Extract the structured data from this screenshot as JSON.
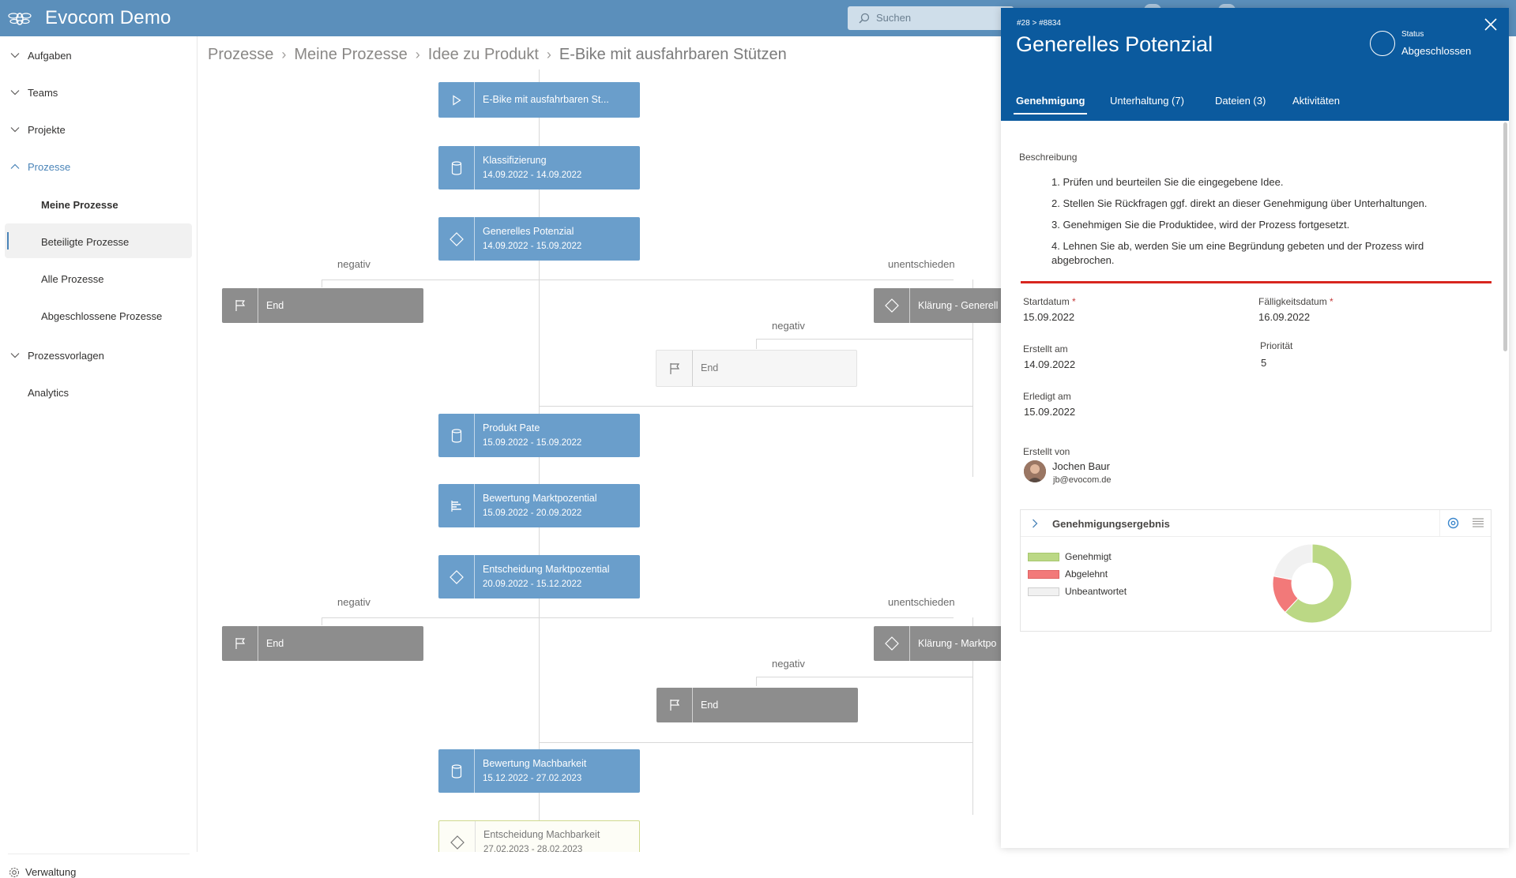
{
  "app": {
    "title": "Evocom Demo",
    "search_placeholder": "Suchen"
  },
  "sidebar": {
    "items": [
      {
        "label": "Aufgaben"
      },
      {
        "label": "Teams"
      },
      {
        "label": "Projekte"
      },
      {
        "label": "Prozesse"
      },
      {
        "label": "Meine Prozesse"
      },
      {
        "label": "Beteiligte Prozesse"
      },
      {
        "label": "Alle Prozesse"
      },
      {
        "label": "Abgeschlossene Prozesse"
      },
      {
        "label": "Prozessvorlagen"
      },
      {
        "label": "Analytics"
      }
    ],
    "footer": "Verwaltung",
    "accent_color": "#4a84b8"
  },
  "breadcrumb": [
    "Prozesse",
    "Meine Prozesse",
    "Idee zu Produkt",
    "E-Bike mit ausfahrbaren Stützen"
  ],
  "flow": {
    "start": {
      "title": "E-Bike mit ausfahrbaren St..."
    },
    "classification": {
      "title": "Klassifizierung",
      "dates": "14.09.2022 - 14.09.2022"
    },
    "potential": {
      "title": "Generelles Potenzial",
      "dates": "14.09.2022 - 15.09.2022"
    },
    "branch_negative_1": "negativ",
    "branch_undecided_1": "unentschieden",
    "end_1": "End",
    "clarify_1": "Klärung - Generell",
    "branch_negative_1b": "negativ",
    "end_1b": "End",
    "pate": {
      "title": "Produkt Pate",
      "dates": "15.09.2022 - 15.09.2022"
    },
    "market_eval": {
      "title": "Bewertung Marktpozential",
      "dates": "15.09.2022 - 20.09.2022"
    },
    "market_decision": {
      "title": "Entscheidung Marktpozential",
      "dates": "20.09.2022 - 15.12.2022"
    },
    "branch_negative_2": "negativ",
    "branch_undecided_2": "unentschieden",
    "end_2": "End",
    "clarify_2": "Klärung - Marktpo",
    "branch_negative_2b": "negativ",
    "end_2b": "End",
    "feasibility": {
      "title": "Bewertung Machbarkeit",
      "dates": "15.12.2022 - 27.02.2023"
    },
    "feasibility_decision": {
      "title": "Entscheidung Machbarkeit",
      "dates": "27.02.2023 - 28.02.2023"
    }
  },
  "panel": {
    "crumb": "#28 >  #8834",
    "title": "Generelles Potenzial",
    "status_label": "Status",
    "status_value": "Abgeschlossen",
    "tabs": [
      "Genehmigung",
      "Unterhaltung (7)",
      "Dateien (3)",
      "Aktivitäten"
    ],
    "description_label": "Beschreibung",
    "description": [
      "1. Prüfen und beurteilen Sie die eingegebene Idee.",
      "2. Stellen Sie Rückfragen ggf. direkt an dieser Genehmigung über Unterhaltungen.",
      "3. Genehmigen Sie die Produktidee, wird der Prozess fortgesetzt.",
      "4. Lehnen Sie ab, werden Sie um eine Begründung gebeten und der Prozess wird abgebrochen."
    ],
    "fields": {
      "start_label": "Startdatum",
      "start_value": "15.09.2022",
      "due_label": "Fälligkeitsdatum",
      "due_value": "16.09.2022",
      "created_label": "Erstellt am",
      "created_value": "14.09.2022",
      "priority_label": "Priorität",
      "priority_value": "5",
      "done_label": "Erledigt am",
      "done_value": "15.09.2022",
      "creator_label": "Erstellt von",
      "creator_name": "Jochen Baur",
      "creator_email": "jb@evocom.de",
      "required_mark": "*"
    },
    "result": {
      "title": "Genehmigungsergebnis",
      "legend": [
        "Genehmigt",
        "Abgelehnt",
        "Unbeantwortet"
      ],
      "colors": [
        "#bbd885",
        "#f27979",
        "#f1f1f1"
      ],
      "values": [
        0.62,
        0.16,
        0.22
      ]
    }
  }
}
